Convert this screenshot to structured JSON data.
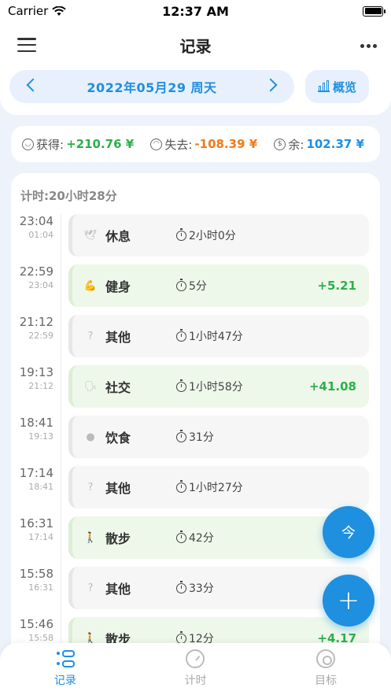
{
  "status": {
    "carrier": "Carrier",
    "time": "12:37 AM"
  },
  "nav": {
    "title": "记录"
  },
  "date_bar": {
    "date": "2022年05月29  周天",
    "overview_label": "概览"
  },
  "summary": {
    "gain_label": "获得:",
    "gain_value": "+210.76 ¥",
    "loss_label": "失去:",
    "loss_value": "-108.39 ¥",
    "balance_label": "余:",
    "balance_value": "102.37 ¥"
  },
  "list": {
    "header": "计时:20小时28分",
    "entries": [
      {
        "start": "23:04",
        "end": "01:04",
        "category": "休息",
        "icon": "dove-icon",
        "duration": "2小时0分",
        "amount": "",
        "highlight": false
      },
      {
        "start": "22:59",
        "end": "23:04",
        "category": "健身",
        "icon": "flexed-bicep-icon",
        "duration": "5分",
        "amount": "+5.21",
        "highlight": true
      },
      {
        "start": "21:12",
        "end": "22:59",
        "category": "其他",
        "icon": "question-icon",
        "duration": "1小时47分",
        "amount": "",
        "highlight": false
      },
      {
        "start": "19:13",
        "end": "21:12",
        "category": "社交",
        "icon": "speaking-head-icon",
        "duration": "1小时58分",
        "amount": "+41.08",
        "highlight": true
      },
      {
        "start": "18:41",
        "end": "19:13",
        "category": "饮食",
        "icon": "plate-icon",
        "duration": "31分",
        "amount": "",
        "highlight": false
      },
      {
        "start": "17:14",
        "end": "18:41",
        "category": "其他",
        "icon": "question-icon",
        "duration": "1小时27分",
        "amount": "",
        "highlight": false
      },
      {
        "start": "16:31",
        "end": "17:14",
        "category": "散步",
        "icon": "walking-person-icon",
        "duration": "42分",
        "amount": "",
        "highlight": true
      },
      {
        "start": "15:58",
        "end": "16:31",
        "category": "其他",
        "icon": "question-icon",
        "duration": "33分",
        "amount": "",
        "highlight": false
      },
      {
        "start": "15:46",
        "end": "15:58",
        "category": "散步",
        "icon": "walking-person-icon",
        "duration": "12分",
        "amount": "+4.17",
        "highlight": true
      }
    ]
  },
  "fab": {
    "today_label": "今",
    "add_label": "+"
  },
  "tabs": [
    {
      "label": "记录",
      "icon": "records-icon",
      "active": true
    },
    {
      "label": "计时",
      "icon": "stopwatch-icon",
      "active": false
    },
    {
      "label": "目标",
      "icon": "target-icon",
      "active": false
    }
  ],
  "colors": {
    "accent": "#1f8fe0",
    "gain": "#2bb04a",
    "loss": "#f07a1a"
  }
}
